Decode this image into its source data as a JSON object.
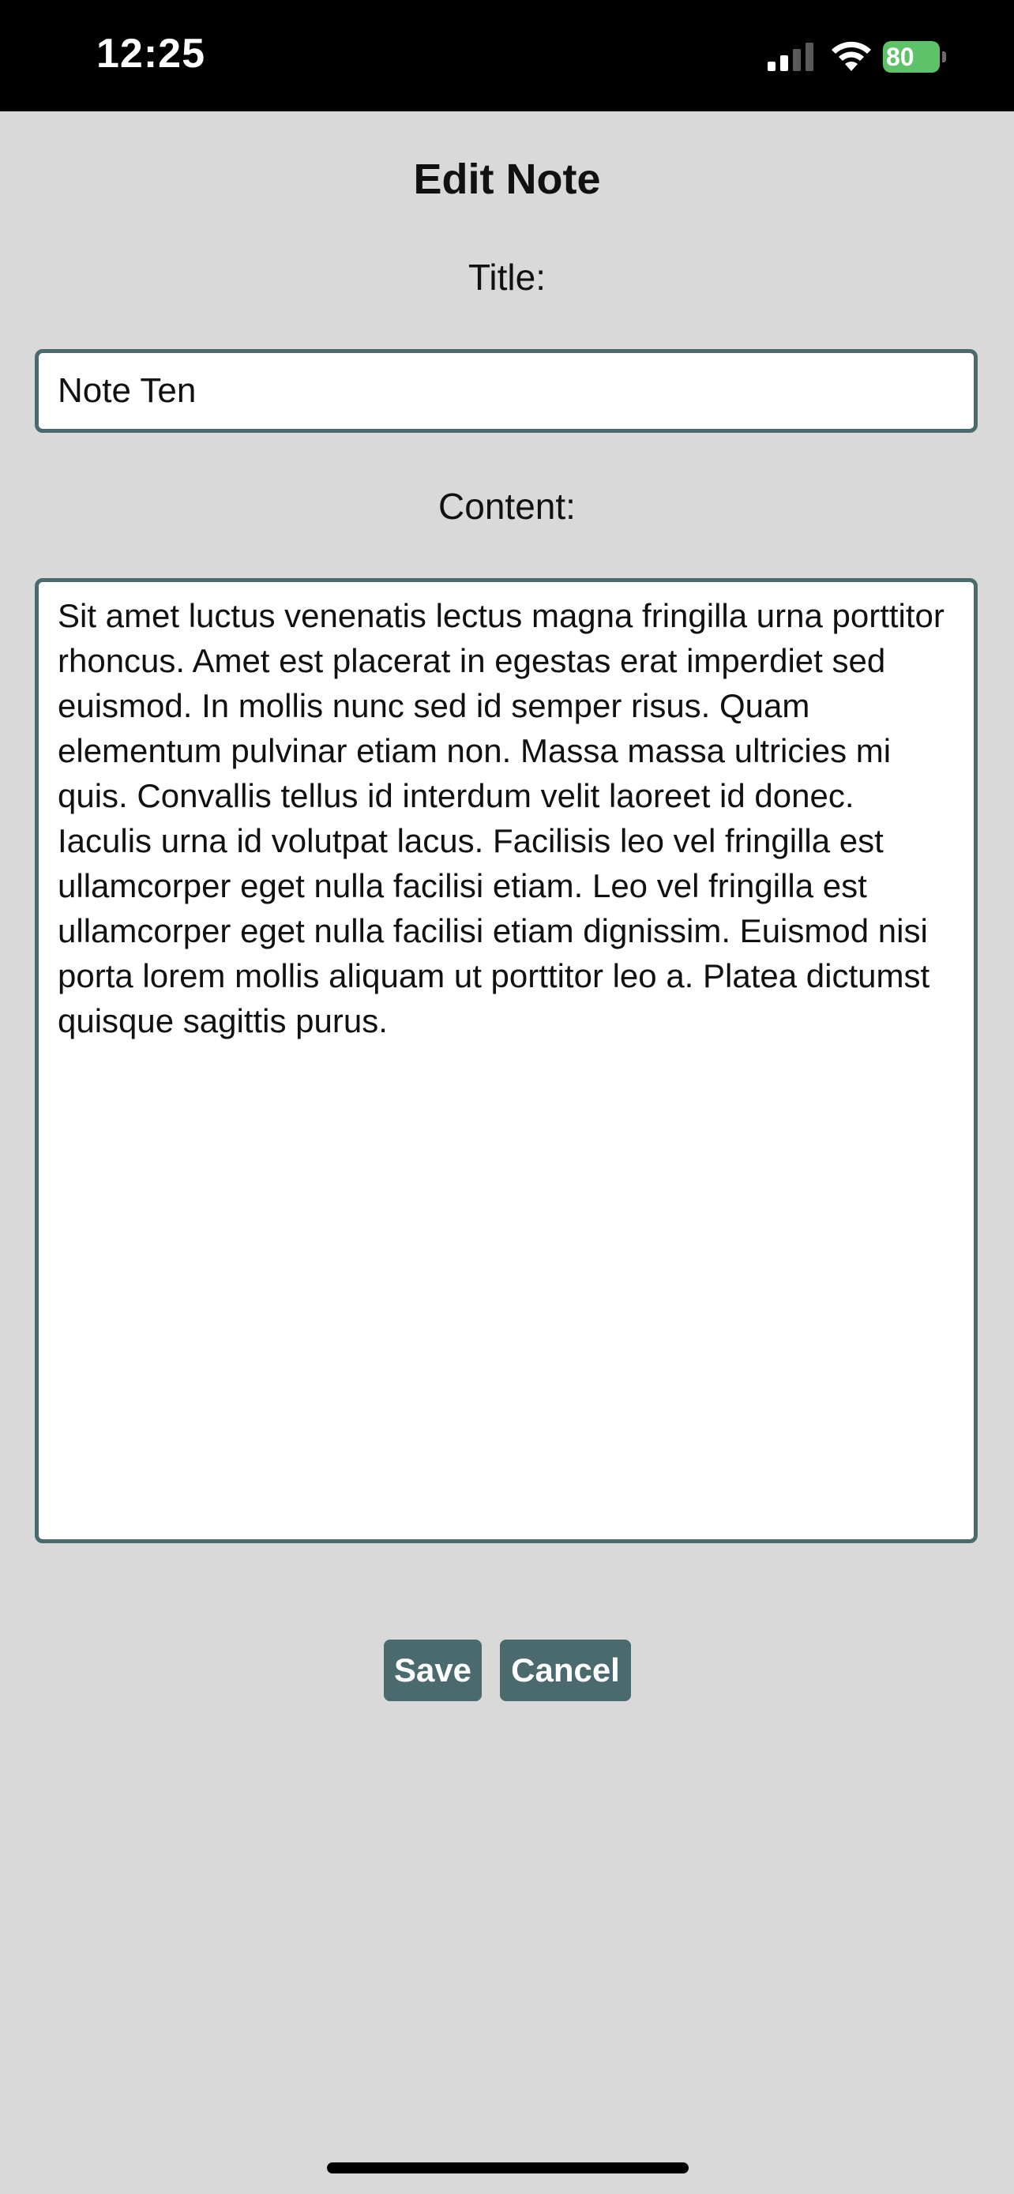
{
  "status_bar": {
    "time": "12:25",
    "battery_percent": "80",
    "signal_icon": "cellular-signal-icon",
    "wifi_icon": "wifi-icon",
    "battery_icon": "battery-charging-icon"
  },
  "page": {
    "heading": "Edit Note"
  },
  "form": {
    "title_label": "Title:",
    "title_value": "Note Ten",
    "content_label": "Content:",
    "content_value": "Sit amet luctus venenatis lectus magna fringilla urna porttitor rhoncus. Amet est placerat in egestas erat imperdiet sed euismod. In mollis nunc sed id semper risus. Quam elementum pulvinar etiam non. Massa massa ultricies mi quis. Convallis tellus id interdum velit laoreet id donec. Iaculis urna id volutpat lacus. Facilisis leo vel fringilla est ullamcorper eget nulla facilisi etiam. Leo vel fringilla est ullamcorper eget nulla facilisi etiam dignissim. Euismod nisi porta lorem mollis aliquam ut porttitor leo a. Platea dictumst quisque sagittis purus."
  },
  "actions": {
    "save_label": "Save",
    "cancel_label": "Cancel"
  },
  "colors": {
    "background": "#d9d9d9",
    "accent": "#4a6a6e",
    "battery": "#5ec269"
  }
}
